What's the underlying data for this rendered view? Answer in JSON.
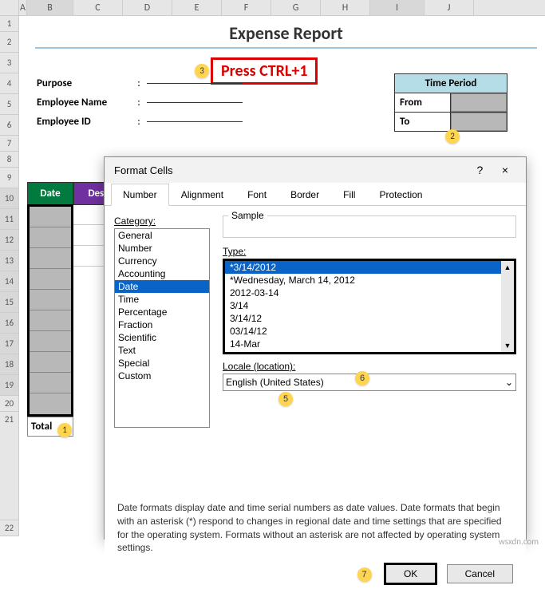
{
  "columns": [
    "A",
    "B",
    "C",
    "D",
    "E",
    "F",
    "G",
    "H",
    "I",
    "J"
  ],
  "title": "Expense Report",
  "instruction": "Press CTRL+1",
  "fields": [
    {
      "label": "Purpose",
      "colon": ":"
    },
    {
      "label": "Employee Name",
      "colon": ":"
    },
    {
      "label": "Employee ID",
      "colon": ":"
    }
  ],
  "period": {
    "header": "Time Period",
    "rows": [
      {
        "label": "From"
      },
      {
        "label": "To"
      }
    ]
  },
  "table": {
    "headers": [
      "Date",
      "Desc"
    ],
    "total_label": "Total"
  },
  "row_numbers_top": [
    "1",
    "2",
    "3",
    "4",
    "5",
    "6",
    "7",
    "8"
  ],
  "row_numbers_data": [
    "9",
    "10",
    "11",
    "12",
    "13",
    "14",
    "15",
    "16",
    "17",
    "18",
    "19",
    "20"
  ],
  "row_numbers_bottom": [
    "21",
    "22"
  ],
  "markers": {
    "1": "1",
    "2": "2",
    "3": "3",
    "4": "4",
    "5": "5",
    "6": "6",
    "7": "7"
  },
  "dialog": {
    "title": "Format Cells",
    "help": "?",
    "close": "×",
    "tabs": [
      "Number",
      "Alignment",
      "Font",
      "Border",
      "Fill",
      "Protection"
    ],
    "active_tab": "Number",
    "category_label": "Category:",
    "categories": [
      "General",
      "Number",
      "Currency",
      "Accounting",
      "Date",
      "Time",
      "Percentage",
      "Fraction",
      "Scientific",
      "Text",
      "Special",
      "Custom"
    ],
    "selected_category": "Date",
    "sample_label": "Sample",
    "type_label": "Type:",
    "types": [
      "*3/14/2012",
      "*Wednesday, March 14, 2012",
      "2012-03-14",
      "3/14",
      "3/14/12",
      "03/14/12",
      "14-Mar"
    ],
    "selected_type": "*3/14/2012",
    "locale_label": "Locale (location):",
    "locale": "English (United States)",
    "help_text": "Date formats display date and time serial numbers as date values. Date formats that begin with an asterisk (*) respond to changes in regional date and time settings that are specified for the operating system. Formats without an asterisk are not affected by operating system settings.",
    "ok": "OK",
    "cancel": "Cancel"
  },
  "watermark": "wsxdn.com"
}
